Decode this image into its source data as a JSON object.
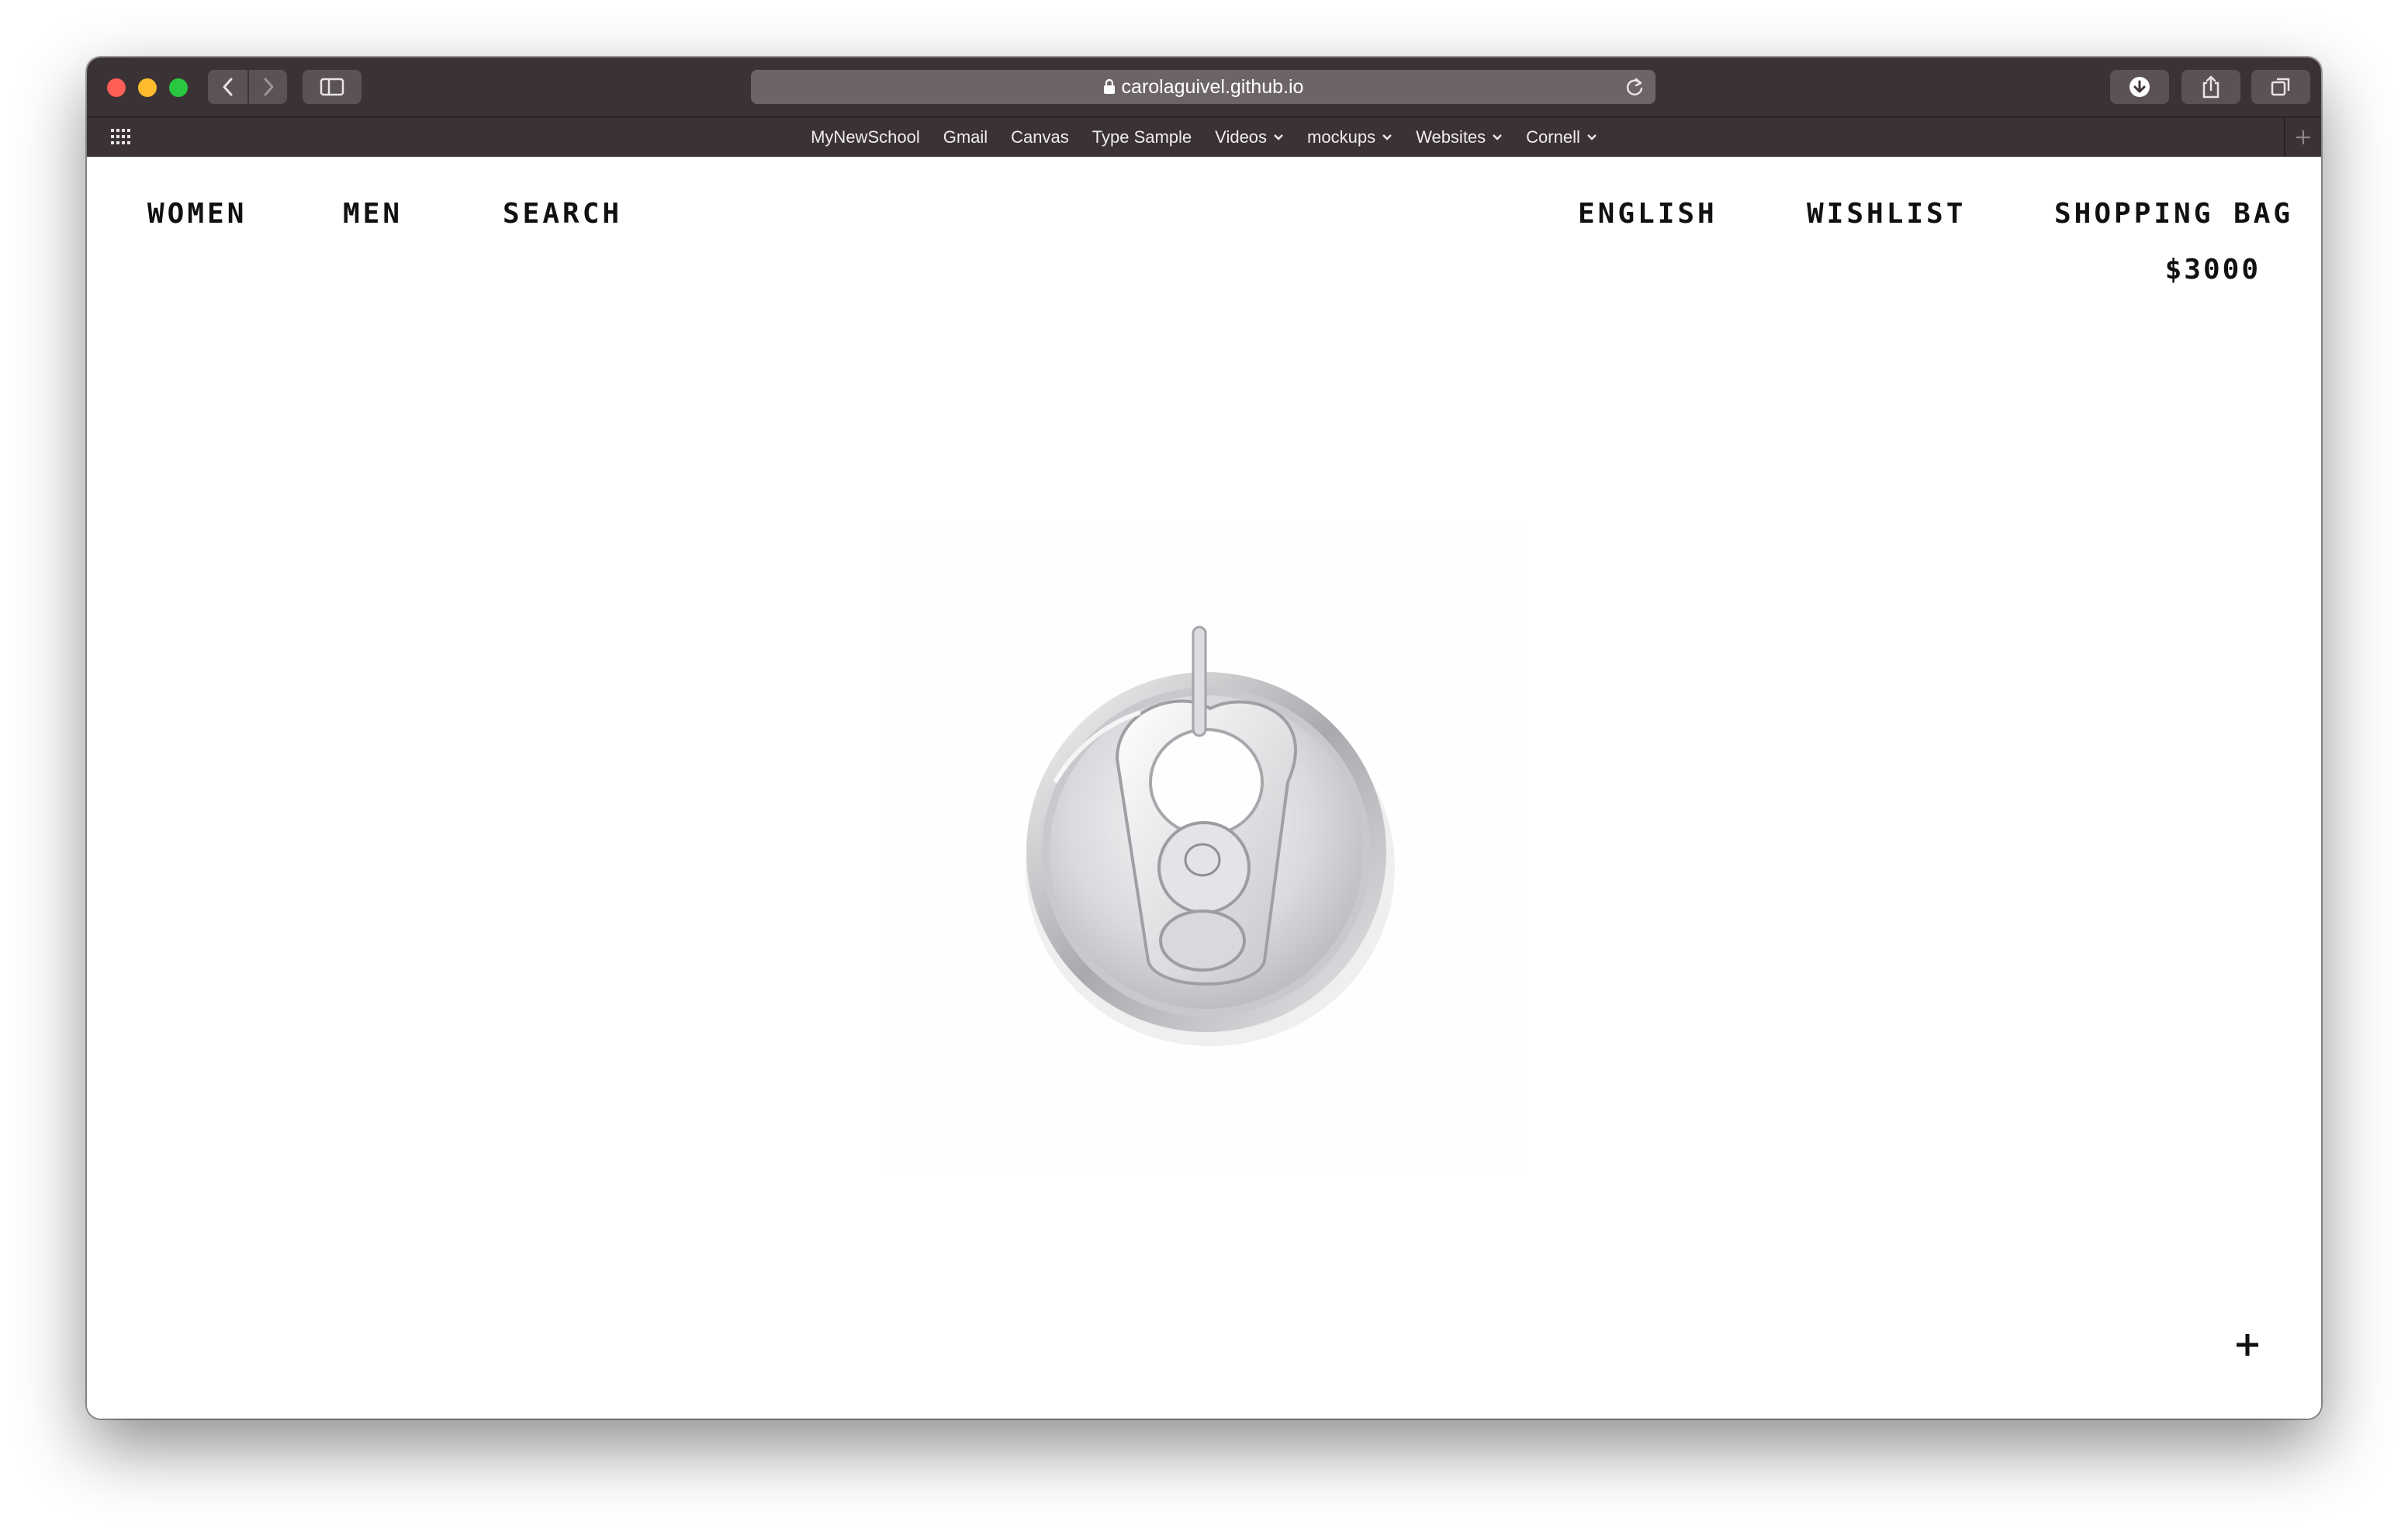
{
  "browser": {
    "url": "carolaguivel.github.io",
    "bookmarks": [
      {
        "label": "MyNewSchool",
        "dropdown": false
      },
      {
        "label": "Gmail",
        "dropdown": false
      },
      {
        "label": "Canvas",
        "dropdown": false
      },
      {
        "label": "Type Sample",
        "dropdown": false
      },
      {
        "label": "Videos",
        "dropdown": true
      },
      {
        "label": "mockups",
        "dropdown": true
      },
      {
        "label": "Websites",
        "dropdown": true
      },
      {
        "label": "Cornell",
        "dropdown": true
      }
    ],
    "icons": [
      "back-icon",
      "forward-icon",
      "sidebar-icon",
      "lock-icon",
      "reload-icon",
      "download-icon",
      "share-icon",
      "tabs-icon",
      "grid-icon",
      "new-tab-plus-icon"
    ]
  },
  "site": {
    "nav_left": [
      "WOMEN",
      "MEN",
      "SEARCH"
    ],
    "nav_right": [
      "ENGLISH",
      "WISHLIST",
      "SHOPPING BAG"
    ],
    "bag_total": "$3000",
    "product_image": "silver-can-tab-pendant",
    "expand_icon": "plus-icon"
  },
  "colors": {
    "titlebar": "#3a3234",
    "text": "#111111",
    "page_bg": "#ffffff"
  }
}
